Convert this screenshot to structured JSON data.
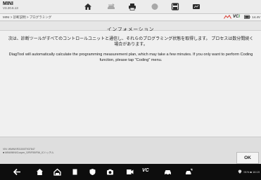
{
  "app": {
    "name": "MINI",
    "version": "V3.20.6.13"
  },
  "toolbar": {
    "icons": [
      "home-icon",
      "vehicle-swap-icon",
      "print-icon",
      "help-icon",
      "save-icon",
      "data-log-icon"
    ],
    "active_color": "#a8a8a8"
  },
  "breadcrumb": {
    "text": "MINI > 診断説明 > プログラミング"
  },
  "vci": {
    "label_prefix": "VC",
    "label_suffix": "i"
  },
  "battery": {
    "value": "14.4V"
  },
  "dialog": {
    "title": "インフォメーション",
    "message_jp": "次は、診断ツールがすべてのコントロールユニットと通信し、それらのプログラミング状態を取得します。 プロセスは数分間続く場合があります。",
    "message_en": "DiagTool will automatically calculate the programming measurement plan, which may take a few minutes. If you only want to perform Coding function, please tap \"Coding\" menu."
  },
  "footer": {
    "vin_line": "VIN: WMWXR31000T937847",
    "vehicle_line": "■ MINI/MINI/Cooper_S/R/F55/F56_ICハッチル",
    "ok_label": "OK"
  },
  "navbar": {
    "vc_label": "VC",
    "status_text": "91% ■ 16:19"
  },
  "colors": {
    "accent_green": "#2a9d3a",
    "accent_red": "#d83a2f"
  }
}
